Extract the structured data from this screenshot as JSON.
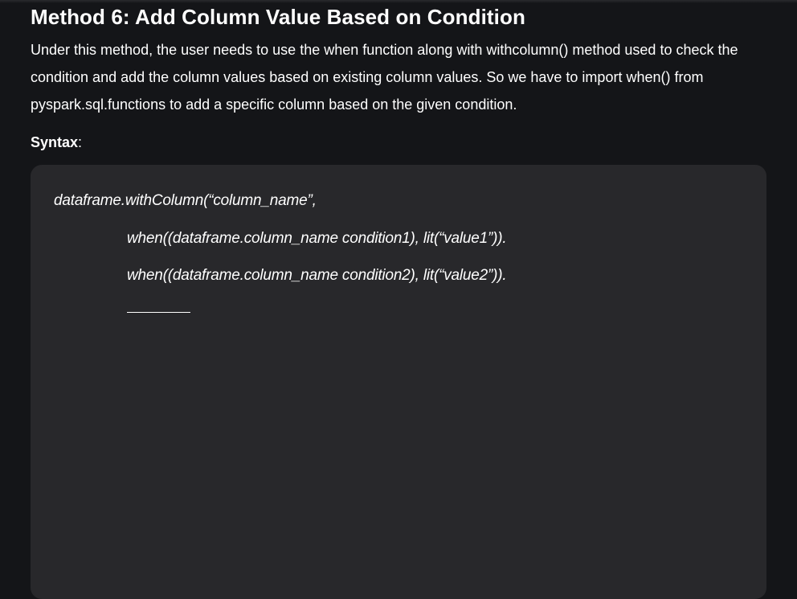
{
  "article": {
    "heading": "Method 6: Add Column Value Based on Condition",
    "intro": "Under this method, the user needs to use the when function along with withcolumn() method used to check the condition and add the column values based on existing column values. So we have to import when() from pyspark.sql.functions to add a specific column based on the given condition.",
    "syntax_label": "Syntax",
    "syntax_suffix": ":"
  },
  "code": {
    "lines": [
      "dataframe.withColumn(“column_name”,",
      "when((dataframe.column_name condition1), lit(“value1”)).",
      "when((dataframe.column_name condition2), lit(“value2”))."
    ]
  }
}
